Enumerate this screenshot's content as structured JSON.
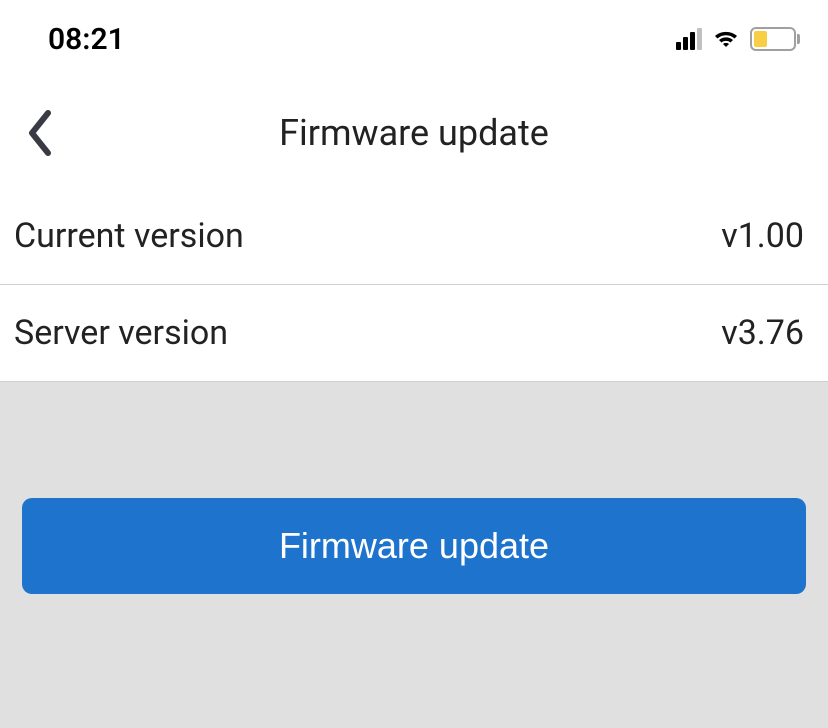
{
  "statusBar": {
    "time": "08:21"
  },
  "nav": {
    "title": "Firmware update"
  },
  "rows": {
    "current": {
      "label": "Current version",
      "value": "v1.00"
    },
    "server": {
      "label": "Server version",
      "value": "v3.76"
    }
  },
  "button": {
    "label": "Firmware update"
  }
}
